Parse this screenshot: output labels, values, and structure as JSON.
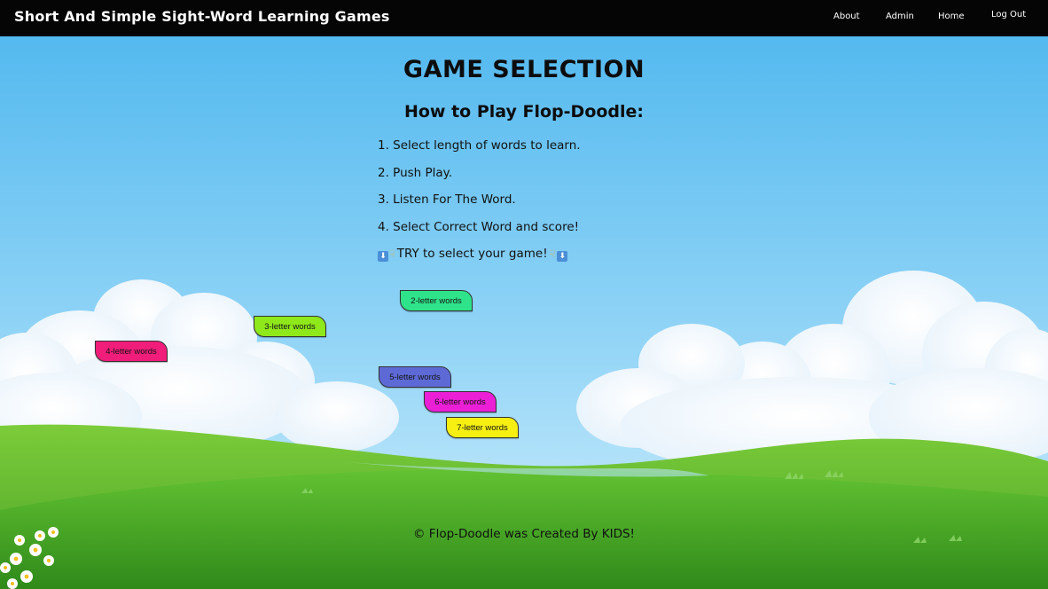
{
  "navbar": {
    "brand": "Short And Simple Sight-Word Learning Games",
    "links": [
      "About",
      "Admin",
      "Home",
      "Log Out"
    ]
  },
  "main": {
    "title": "GAME SELECTION",
    "how_to_title": "How to Play Flop-Doodle:",
    "steps": [
      "1. Select length of words to learn.",
      "2. Push Play.",
      "3. Listen For The Word.",
      "4. Select Correct Word and score!"
    ],
    "try_text": "TRY to select your game!",
    "game_buttons": [
      {
        "label": "2-letter words",
        "color": "#2fe38a"
      },
      {
        "label": "3-letter words",
        "color": "#8ee81a"
      },
      {
        "label": "4-letter words",
        "color": "#f01d7a"
      },
      {
        "label": "5-letter words",
        "color": "#5d6ad6"
      },
      {
        "label": "6-letter words",
        "color": "#ea1fd6"
      },
      {
        "label": "7-letter words",
        "color": "#f6ef11"
      }
    ]
  },
  "footer": {
    "text": "© Flop-Doodle was Created By KIDS!"
  },
  "icons": [
    "down-arrow-icon",
    "pointing-down-icon"
  ]
}
